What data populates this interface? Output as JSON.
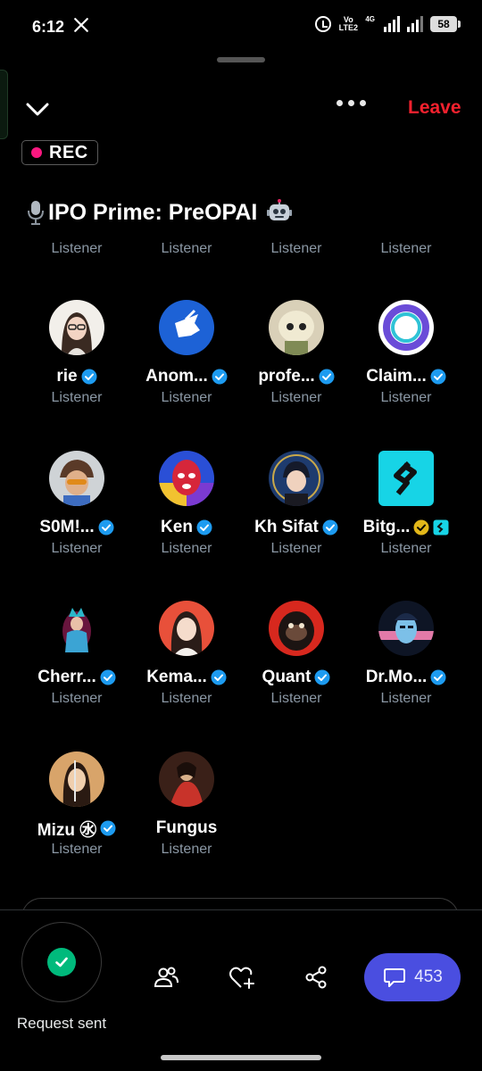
{
  "status_bar": {
    "time": "6:12",
    "app_icon": "x-logo",
    "network_label": "Vo LTE2",
    "network_type": "4G",
    "battery": "58"
  },
  "header": {
    "leave_label": "Leave",
    "rec_label": "REC",
    "title": "IPO Prime: PreOPAI",
    "title_icons": [
      "microphone-icon",
      "robot-icon"
    ]
  },
  "partial_row_roles": [
    "Listener",
    "Listener",
    "Listener",
    "Listener"
  ],
  "listeners": [
    {
      "name": "rie",
      "role": "Listener",
      "verified": "blue"
    },
    {
      "name": "Anom...",
      "role": "Listener",
      "verified": "blue"
    },
    {
      "name": "profe...",
      "role": "Listener",
      "verified": "blue"
    },
    {
      "name": "Claim...",
      "role": "Listener",
      "verified": "blue"
    },
    {
      "name": "S0M!...",
      "role": "Listener",
      "verified": "blue"
    },
    {
      "name": "Ken",
      "role": "Listener",
      "verified": "blue"
    },
    {
      "name": "Kh Sifat",
      "role": "Listener",
      "verified": "blue"
    },
    {
      "name": "Bitg...",
      "role": "Listener",
      "verified": "gold"
    },
    {
      "name": "Cherr...",
      "role": "Listener",
      "verified": "blue"
    },
    {
      "name": "Kema...",
      "role": "Listener",
      "verified": "blue"
    },
    {
      "name": "Quant",
      "role": "Listener",
      "verified": "blue"
    },
    {
      "name": "Dr.Mo...",
      "role": "Listener",
      "verified": "blue"
    },
    {
      "name": "Mizu ㊌",
      "role": "Listener",
      "verified": "blue"
    },
    {
      "name": "Fungus",
      "role": "Listener",
      "verified": "none"
    }
  ],
  "bottom": {
    "request_label": "Request sent",
    "chat_count": "453",
    "icons": [
      "people-icon",
      "heart-plus-icon",
      "share-icon",
      "chat-bubble-icon"
    ]
  },
  "colors": {
    "leave": "#f4212e",
    "rec_dot": "#f91880",
    "verified_blue": "#1d9bf0",
    "verified_gold": "#e2b719",
    "request_check": "#00ba7c",
    "chat_pill": "#4a4ee0"
  }
}
